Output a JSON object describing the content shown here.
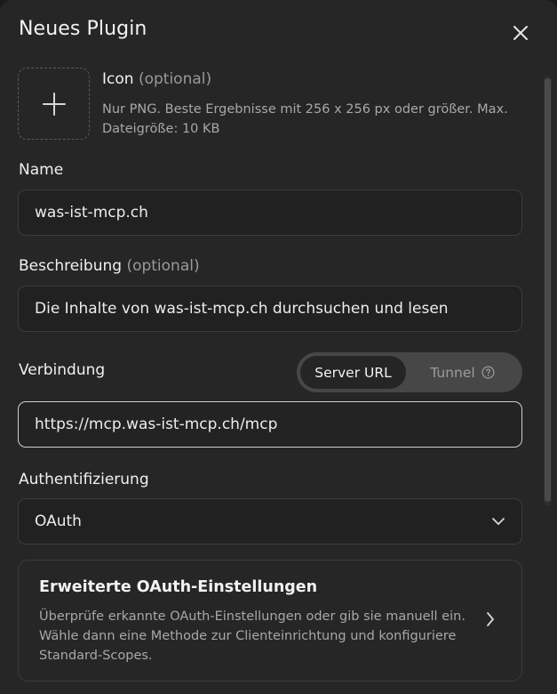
{
  "dialog": {
    "title": "Neues Plugin",
    "close_icon": "close-icon"
  },
  "icon_section": {
    "label": "Icon",
    "optional": "(optional)",
    "hint": "Nur PNG. Beste Ergebnisse mit 256 x 256 px oder größer. Max. Dateigröße: 10 KB",
    "upload_icon": "plus-icon"
  },
  "name": {
    "label": "Name",
    "value": "was-ist-mcp.ch"
  },
  "description": {
    "label": "Beschreibung",
    "optional": "(optional)",
    "value": "Die Inhalte von was-ist-mcp.ch durchsuchen und lesen"
  },
  "connection": {
    "label": "Verbindung",
    "options": [
      "Server URL",
      "Tunnel"
    ],
    "selected": "Server URL",
    "tunnel_help_icon": "help-circle-icon",
    "url_value": "https://mcp.was-ist-mcp.ch/mcp"
  },
  "auth": {
    "label": "Authentifizierung",
    "selected": "OAuth",
    "dropdown_icon": "chevron-down-icon"
  },
  "advanced": {
    "title": "Erweiterte OAuth-Einstellungen",
    "description": "Überprüfe erkannte OAuth-Einstellungen oder gib sie manuell ein. Wähle dann eine Methode zur Clienteinrichtung und konfiguriere Standard-Scopes.",
    "chevron_icon": "chevron-right-icon"
  },
  "colors": {
    "background": "#262626",
    "field_background": "#212121",
    "field_border": "#3c3c3c",
    "focused_border": "#cfcfcf",
    "segment_track": "#474747",
    "muted_text": "#a8a8a8"
  }
}
